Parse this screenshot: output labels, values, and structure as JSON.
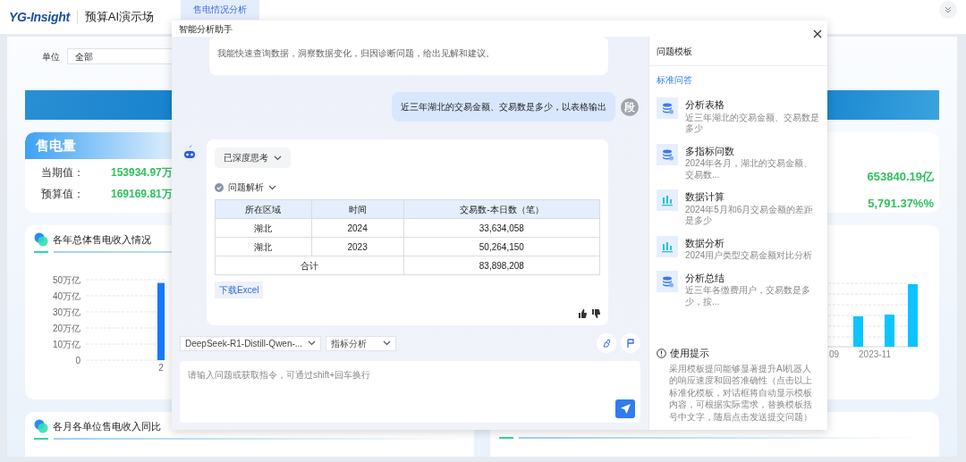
{
  "header": {
    "logo": "YG-Insight",
    "title": "预算AI演示场",
    "tabs": [
      {
        "label": "售电情况分析",
        "selected": true
      }
    ]
  },
  "filter": {
    "label": "单位",
    "value": "全部"
  },
  "sales_card": {
    "title": "售电量",
    "rows": [
      {
        "label": "当期值：",
        "value": "153934.97万"
      },
      {
        "label": "预算值：",
        "value": "169169.81万"
      }
    ]
  },
  "right_card": {
    "values": [
      "653840.19亿",
      "5,791.37%%"
    ]
  },
  "income_chart": {
    "title": "各年总体售电收入情况",
    "chart_data": {
      "type": "bar",
      "grid": true,
      "categories": [
        "2"
      ],
      "values": [
        48
      ],
      "ylim": [
        0,
        50
      ],
      "yticks": [
        {
          "value": 0,
          "label": "0"
        },
        {
          "value": 10,
          "label": "10万亿"
        },
        {
          "value": 20,
          "label": "20万亿"
        },
        {
          "value": 30,
          "label": "30万亿"
        },
        {
          "value": 40,
          "label": "40万亿"
        },
        {
          "value": 50,
          "label": "50万亿"
        }
      ]
    }
  },
  "right_chart": {
    "x_labels": [
      "09",
      "2023-11"
    ]
  },
  "monthly_card": {
    "title": "各月各单位售电收入同比"
  },
  "assistant": {
    "title": "智能分析助手",
    "messages": [
      {
        "kind": "bot_text",
        "text": "我能快速查询数据，洞察数据变化，归因诊断问题，给出见解和建议。"
      },
      {
        "kind": "user",
        "text": "近三年湖北的交易金额、交易数是多少，以表格输出",
        "avatar": "段"
      },
      {
        "kind": "bot_table",
        "thinking": "已深度思考",
        "analysis": "问题解析",
        "table": {
          "columns": [
            "所在区域",
            "时间",
            "交易数-本日数（笔）"
          ],
          "rows": [
            [
              "湖北",
              "2024",
              "33,634,058"
            ],
            [
              "湖北",
              "2023",
              "50,264,150"
            ]
          ],
          "total": {
            "label": "合计",
            "value": "83,898,208"
          }
        },
        "download": "下载Excel"
      }
    ],
    "model_select": "DeepSeek-R1-Distill-Qwen-...",
    "mode_select": "指标分析",
    "input": {
      "placeholder": "请输入问题或获取指令，可通过shift+回车换行"
    },
    "templates": {
      "title": "问题模板",
      "tab": "标准问答",
      "items": [
        {
          "kind": "database",
          "title": "分析表格",
          "subtitle": "近三年湖北的交易金额、交易数是多少"
        },
        {
          "kind": "database",
          "title": "多指标问数",
          "subtitle": "2024年各月，湖北的交易金额、交易数..."
        },
        {
          "kind": "chart",
          "title": "数据计算",
          "subtitle": "2024年5月和6月交易金额的差距是多少"
        },
        {
          "kind": "chart",
          "title": "数据分析",
          "subtitle": "2024用户类型交易金额对比分析"
        },
        {
          "kind": "database",
          "title": "分析总结",
          "subtitle": "近三年各缴费用户，交易数是多少，按..."
        }
      ]
    },
    "tips": {
      "title": "使用提示",
      "text": "采用模板提问能够显著提升AI机器人的响应速度和回答准确性（点击以上标准化模板，对话框将自动显示模板内容，可根据实际需求，替换模板括号中文字，随后点击发送提交问题）"
    }
  }
}
